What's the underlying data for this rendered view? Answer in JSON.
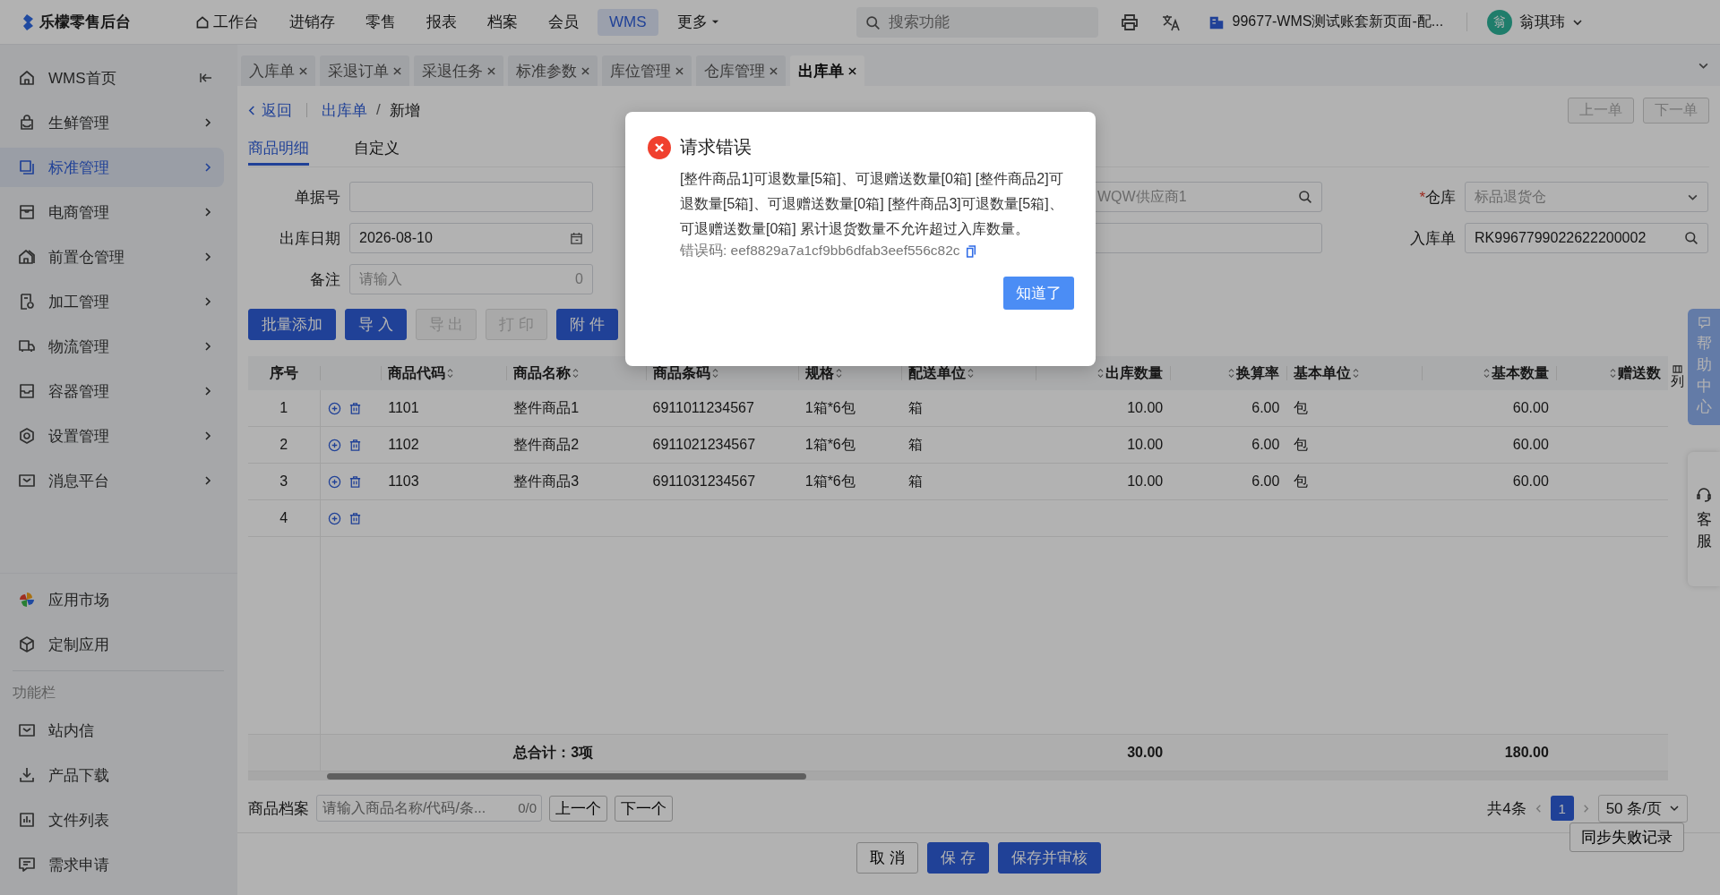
{
  "topbar": {
    "logo": "乐檬零售后台",
    "nav": [
      {
        "label": "工作台",
        "selected": false
      },
      {
        "label": "进销存",
        "selected": false
      },
      {
        "label": "零售",
        "selected": false
      },
      {
        "label": "报表",
        "selected": false
      },
      {
        "label": "档案",
        "selected": false
      },
      {
        "label": "会员",
        "selected": false
      },
      {
        "label": "WMS",
        "selected": true
      }
    ],
    "more": "更多",
    "search_placeholder": "搜索功能",
    "account": "99677-WMS测试账套新页面-配...",
    "avatar": "翁",
    "user": "翁琪玮"
  },
  "sidebar": {
    "items": [
      {
        "label": "WMS首页",
        "selected": false
      },
      {
        "label": "生鲜管理",
        "selected": false
      },
      {
        "label": "标准管理",
        "selected": true
      },
      {
        "label": "电商管理",
        "selected": false
      },
      {
        "label": "前置仓管理",
        "selected": false
      },
      {
        "label": "加工管理",
        "selected": false
      },
      {
        "label": "物流管理",
        "selected": false
      },
      {
        "label": "容器管理",
        "selected": false
      },
      {
        "label": "设置管理",
        "selected": false
      },
      {
        "label": "消息平台",
        "selected": false
      }
    ],
    "apps": [
      "应用市场",
      "定制应用"
    ],
    "section_title": "功能栏",
    "tools": [
      "站内信",
      "产品下载",
      "文件列表",
      "需求申请"
    ]
  },
  "tabs": [
    {
      "label": "入库单",
      "selected": false
    },
    {
      "label": "采退订单",
      "selected": false
    },
    {
      "label": "采退任务",
      "selected": false
    },
    {
      "label": "标准参数",
      "selected": false
    },
    {
      "label": "库位管理",
      "selected": false
    },
    {
      "label": "仓库管理",
      "selected": false
    },
    {
      "label": "出库单",
      "selected": true
    }
  ],
  "breadcrumb": {
    "back": "返回",
    "parent": "出库单",
    "separator": "/",
    "current": "新增"
  },
  "record_nav": [
    "上一单",
    "下一单"
  ],
  "sub_tabs": [
    {
      "label": "商品明细",
      "selected": true
    },
    {
      "label": "自定义",
      "selected": false
    }
  ],
  "form": {
    "left": [
      {
        "label": "单据号"
      },
      {
        "label": "出库日期",
        "value": "2026-08-10"
      },
      {
        "label": "备注",
        "placeholder": "请输入",
        "counter": "0"
      }
    ],
    "middle": [
      {
        "value": "WQW供应商1"
      }
    ],
    "right": [
      {
        "label": "仓库",
        "required_mark": "*",
        "value": "标品退货仓"
      },
      {
        "label": "入库单",
        "value": "RK9967799022622200002"
      }
    ]
  },
  "toolbar": [
    {
      "label": "批量添加",
      "disabled": false
    },
    {
      "label": "导 入",
      "disabled": false
    },
    {
      "label": "导 出",
      "disabled": true
    },
    {
      "label": "打 印",
      "disabled": true
    },
    {
      "label": "附 件",
      "disabled": false
    }
  ],
  "table": {
    "columns": [
      "序号",
      "商品代码",
      "商品名称",
      "商品条码",
      "规格",
      "配送单位",
      "出库数量",
      "换算率",
      "基本单位",
      "基本数量",
      "赠送数"
    ],
    "rows": [
      {
        "index": "1",
        "code": "1101",
        "name": "整件商品1",
        "barcode": "6911011234567",
        "spec": "1箱*6包",
        "unit": "箱",
        "qty": "10.00",
        "rate": "6.00",
        "base_unit": "包",
        "base_qty": "60.00"
      },
      {
        "index": "2",
        "code": "1102",
        "name": "整件商品2",
        "barcode": "6911021234567",
        "spec": "1箱*6包",
        "unit": "箱",
        "qty": "10.00",
        "rate": "6.00",
        "base_unit": "包",
        "base_qty": "60.00"
      },
      {
        "index": "3",
        "code": "1103",
        "name": "整件商品3",
        "barcode": "6911031234567",
        "spec": "1箱*6包",
        "unit": "箱",
        "qty": "10.00",
        "rate": "6.00",
        "base_unit": "包",
        "base_qty": "60.00"
      },
      {
        "index": "4"
      }
    ],
    "totals": {
      "label": "总合计：3项",
      "qty": "30.00",
      "base_qty": "180.00"
    },
    "column_settings": "列"
  },
  "archive": {
    "label": "商品档案",
    "placeholder": "请输入商品名称/代码/条...",
    "count": "0/0",
    "prev": "上一个",
    "next": "下一个"
  },
  "pagination": {
    "total": "共4条",
    "pages": [
      {
        "label": "1",
        "selected": true
      }
    ],
    "page_size": "50 条/页",
    "sync_failed": "同步失败记录"
  },
  "footer_buttons": [
    {
      "label": "取 消",
      "primary": false
    },
    {
      "label": "保 存",
      "primary": true
    },
    {
      "label": "保存并审核",
      "primary": true
    }
  ],
  "float": {
    "help": "帮助中心",
    "service": "客服"
  },
  "dialog": {
    "title": "请求错误",
    "message": "[整件商品1]可退数量[5箱]、可退赠送数量[0箱] [整件商品2]可退数量[5箱]、可退赠送数量[0箱] [整件商品3]可退数量[5箱]、可退赠送数量[0箱] 累计退货数量不允许超过入库数量。",
    "error_code": "错误码: eef8829a7a1cf9bb6dfab3eef556c82c",
    "ok": "知道了"
  }
}
